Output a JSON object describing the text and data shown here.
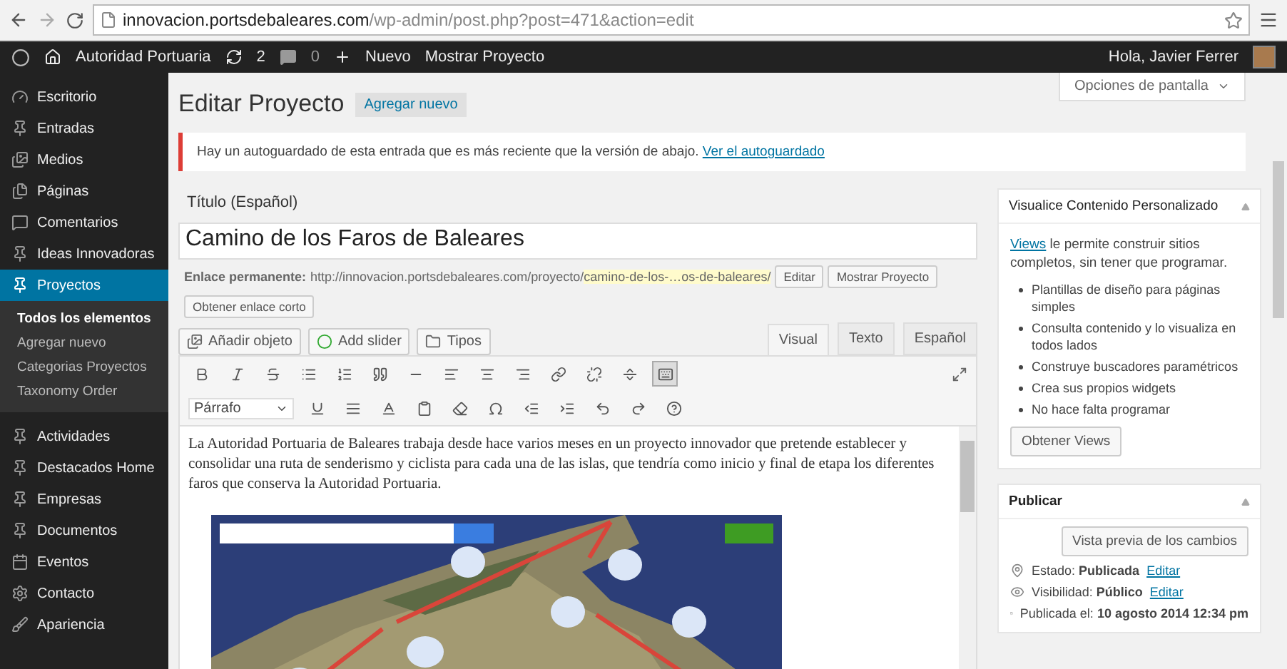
{
  "browser": {
    "url_host": "innovacion.portsdebaleares.com",
    "url_path": "/wp-admin/post.php?post=471&action=edit"
  },
  "admin_bar": {
    "site": "Autoridad Portuaria",
    "updates": "2",
    "comments": "0",
    "new": "Nuevo",
    "view": "Mostrar Proyecto",
    "greeting": "Hola, Javier Ferrer"
  },
  "sidebar": {
    "items": [
      {
        "label": "Escritorio",
        "selected": false
      },
      {
        "label": "Entradas",
        "selected": false
      },
      {
        "label": "Medios",
        "selected": false
      },
      {
        "label": "Páginas",
        "selected": false
      },
      {
        "label": "Comentarios",
        "selected": false
      },
      {
        "label": "Ideas Innovadoras",
        "selected": false
      },
      {
        "label": "Proyectos",
        "selected": true,
        "children": [
          {
            "label": "Todos los elementos",
            "selected": true
          },
          {
            "label": "Agregar nuevo",
            "selected": false
          },
          {
            "label": "Categorias Proyectos",
            "selected": false
          },
          {
            "label": "Taxonomy Order",
            "selected": false
          }
        ]
      },
      {
        "label": "Actividades",
        "selected": false
      },
      {
        "label": "Destacados Home",
        "selected": false
      },
      {
        "label": "Empresas",
        "selected": false
      },
      {
        "label": "Documentos",
        "selected": false
      },
      {
        "label": "Eventos",
        "selected": false
      },
      {
        "label": "Contacto",
        "selected": false
      },
      {
        "label": "Apariencia",
        "selected": false
      }
    ]
  },
  "screen_options": "Opciones de pantalla",
  "page": {
    "title": "Editar Proyecto",
    "add_new": "Agregar nuevo"
  },
  "notice": {
    "text": "Hay un autoguardado de esta entrada que es más reciente que la versión de abajo.",
    "link": "Ver el autoguardado"
  },
  "title_field": {
    "label": "Título (Español)",
    "value": "Camino de los Faros de Baleares"
  },
  "permalink": {
    "label": "Enlace permanente:",
    "url": "http://innovacion.portsdebaleares.com/proyecto/",
    "slug": "camino-de-los-…os-de-baleares/",
    "buttons": [
      "Editar",
      "Mostrar Proyecto"
    ],
    "shortlink": "Obtener enlace corto"
  },
  "media_buttons": [
    "Añadir objeto",
    "Add slider",
    "Tipos"
  ],
  "editor": {
    "tabs": [
      {
        "label": "Visual",
        "selected": true
      },
      {
        "label": "Texto",
        "selected": false
      },
      {
        "label": "Español",
        "selected": false
      }
    ],
    "toolbar_toggle_pressed": true,
    "format": "Párrafo",
    "body": "La Autoridad Portuaria de Baleares trabaja desde hace varios meses en un proyecto innovador que pretende establecer y consolidar una ruta de senderismo y ciclista para cada una de las islas, que tendría como inicio y final de etapa los diferentes faros que conserva la Autoridad Portuaria."
  },
  "views_box": {
    "title": "Visualice Contenido Personalizado",
    "intro_link": "Views",
    "intro": " le permite construir sitios completos, sin tener que programar.",
    "bullets": [
      "Plantillas de diseño para páginas simples",
      "Consulta contenido y lo visualiza en todos lados",
      "Construye buscadores paramétricos",
      "Crea sus propios widgets",
      "No hace falta programar"
    ],
    "button": "Obtener Views"
  },
  "publish_box": {
    "title": "Publicar",
    "preview": "Vista previa de los cambios",
    "rows": [
      {
        "label": "Estado:",
        "value": "Publicada",
        "link": "Editar"
      },
      {
        "label": "Visibilidad:",
        "value": "Público",
        "link": "Editar"
      },
      {
        "label": "Publicada el:",
        "value": "10 agosto 2014 12:34 pm"
      }
    ]
  }
}
